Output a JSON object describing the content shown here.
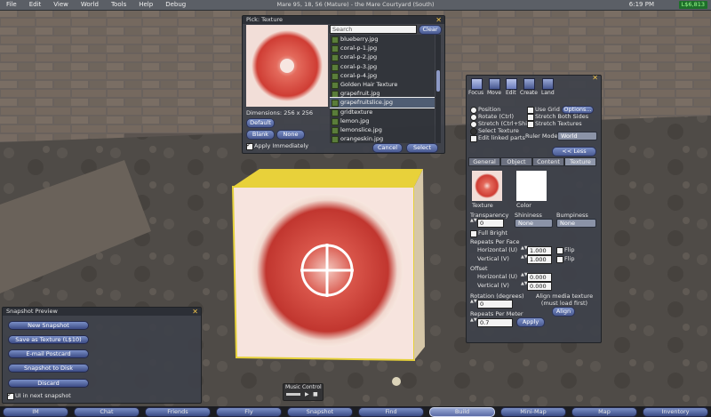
{
  "menu": {
    "items": [
      "File",
      "Edit",
      "View",
      "World",
      "Tools",
      "Help",
      "Debug"
    ]
  },
  "status": {
    "location": "Mare 95, 18, 56 (Mature) - the Mare Courtyard (South)",
    "clock": "6:19 PM",
    "balance": "L$6,813"
  },
  "texture_picker": {
    "title": "Pick: Texture",
    "dimensions": "Dimensions: 256 x 256",
    "default_label": "Default",
    "blank_label": "Blank",
    "none_label": "None",
    "apply_immediately_label": "Apply Immediately",
    "apply_immediately": true,
    "search_placeholder": "Search",
    "clear_label": "Clear",
    "cancel_label": "Cancel",
    "select_label": "Select",
    "items": [
      "blueberry.jpg",
      "coral-p-1.jpg",
      "coral-p-2.jpg",
      "coral-p-3.jpg",
      "coral-p-4.jpg",
      "Golden Hair Texture",
      "grapefruit.jpg",
      "grapefruitslice.jpg",
      "gridtexture",
      "lemon.jpg",
      "lemonslice.jpg",
      "orangeskin.jpg"
    ],
    "selected_index": 7
  },
  "build_tools": {
    "tools": [
      "Focus",
      "Move",
      "Edit",
      "Create",
      "Land"
    ],
    "active_tool": "Edit",
    "options": {
      "position": "Position",
      "rotate": "Rotate (Ctrl)",
      "stretch": "Stretch (Ctrl+Shift)",
      "select_texture": "Select Texture",
      "edit_linked": "Edit linked parts",
      "use_grid": "Use Grid",
      "grid_options": "Options...",
      "stretch_both": "Stretch Both Sides",
      "stretch_textures": "Stretch Textures",
      "ruler_mode_label": "Ruler Mode:",
      "ruler_mode_value": "World"
    },
    "less_label": "<< Less",
    "tabs": [
      "General",
      "Object",
      "Content",
      "Texture"
    ],
    "active_tab": "Texture",
    "texture_label": "Texture",
    "color_label": "Color",
    "transparency_label": "Transparency",
    "transparency_value": "0",
    "shininess_label": "Shininess",
    "shininess_value": "None",
    "bumpiness_label": "Bumpiness",
    "bumpiness_value": "None",
    "full_bright_label": "Full Bright",
    "repeats_label": "Repeats Per Face",
    "horizontal_u_label": "Horizontal (U)",
    "horizontal_u_value": "1.000",
    "vertical_v_label": "Vertical (V)",
    "vertical_v_value": "1.000",
    "flip_label": "Flip",
    "offset_label": "Offset",
    "offset_u_value": "0.000",
    "offset_v_value": "0.000",
    "rotation_label": "Rotation (degrees)",
    "rotation_value": "0",
    "align_media_label": "Align media texture (must load first)",
    "align_label": "Align",
    "repeats_meter_label": "Repeats Per Meter",
    "repeats_meter_value": "0.7",
    "apply_label": "Apply"
  },
  "snapshot_preview": {
    "title": "Snapshot Preview",
    "buttons": [
      "New Snapshot",
      "Save as Texture (L$10)",
      "E-mail Postcard",
      "Snapshot to Disk",
      "Discard"
    ],
    "ui_checkbox_label": "UI in next snapshot",
    "ui_checked": true
  },
  "music_control": {
    "label": "Music Control"
  },
  "bottom_bar": {
    "buttons": [
      "IM",
      "Chat",
      "Friends",
      "Fly",
      "Snapshot",
      "Find",
      "Build",
      "Mini-Map",
      "Map",
      "Inventory"
    ],
    "active": "Build"
  },
  "colors": {
    "accent_blue": "#5a6aa6",
    "close_icon": "#f0c44c",
    "balance_green": "#1e6f2a",
    "cube_glow": "#e8d13a"
  }
}
